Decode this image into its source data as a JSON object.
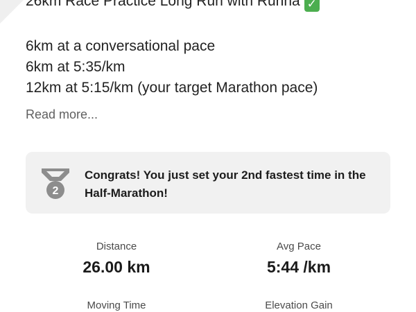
{
  "activity": {
    "title": "26km Race Practice Long Run with Runna",
    "title_icon": "check-mark-icon",
    "description": [
      "6km at a conversational pace",
      "6km at 5:35/km",
      "12km at 5:15/km (your target Marathon pace)"
    ],
    "read_more": "Read more..."
  },
  "achievement": {
    "medal_icon": "medal-icon",
    "medal_number": "2",
    "text": "Congrats! You just set your 2nd fastest time in the Half-Marathon!"
  },
  "stats": [
    {
      "label": "Distance",
      "value": "26.00 km"
    },
    {
      "label": "Avg Pace",
      "value": "5:44 /km"
    },
    {
      "label": "Moving Time",
      "value": ""
    },
    {
      "label": "Elevation Gain",
      "value": ""
    }
  ],
  "colors": {
    "check_green": "#4cae4f",
    "medal_gray": "#8d8d8d",
    "banner_bg": "#f1f1f1"
  }
}
